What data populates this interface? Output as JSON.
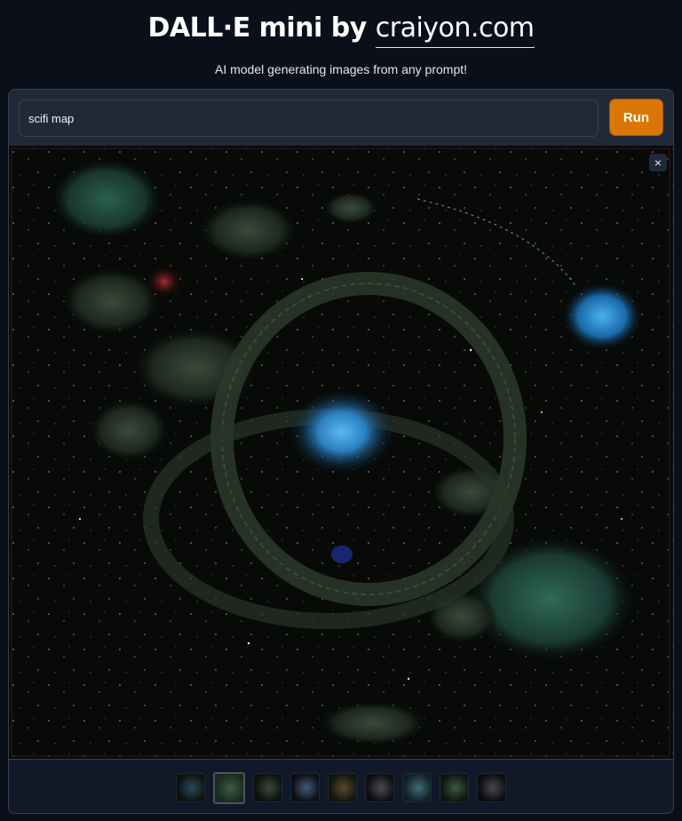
{
  "header": {
    "title_prefix": "DALL·E mini by ",
    "title_link": "craiyon.com",
    "subtitle": "AI model generating images from any prompt!"
  },
  "prompt": {
    "value": "scifi map",
    "run_label": "Run"
  },
  "gallery": {
    "close_label": "×",
    "thumbnails": [
      {
        "selected": false,
        "colors": [
          "#0d1210",
          "#2c4b5a"
        ]
      },
      {
        "selected": true,
        "colors": [
          "#1a2a1e",
          "#3c5a46"
        ]
      },
      {
        "selected": false,
        "colors": [
          "#0b0f0f",
          "#3a4a3a"
        ]
      },
      {
        "selected": false,
        "colors": [
          "#0e0e12",
          "#3f5a7a"
        ]
      },
      {
        "selected": false,
        "colors": [
          "#10140f",
          "#5a4a2a"
        ]
      },
      {
        "selected": false,
        "colors": [
          "#0d0d10",
          "#4a4a55"
        ]
      },
      {
        "selected": false,
        "colors": [
          "#112025",
          "#3e6c78"
        ]
      },
      {
        "selected": false,
        "colors": [
          "#0e1410",
          "#3b5840"
        ]
      },
      {
        "selected": false,
        "colors": [
          "#0c0c0e",
          "#44484e"
        ]
      }
    ]
  }
}
